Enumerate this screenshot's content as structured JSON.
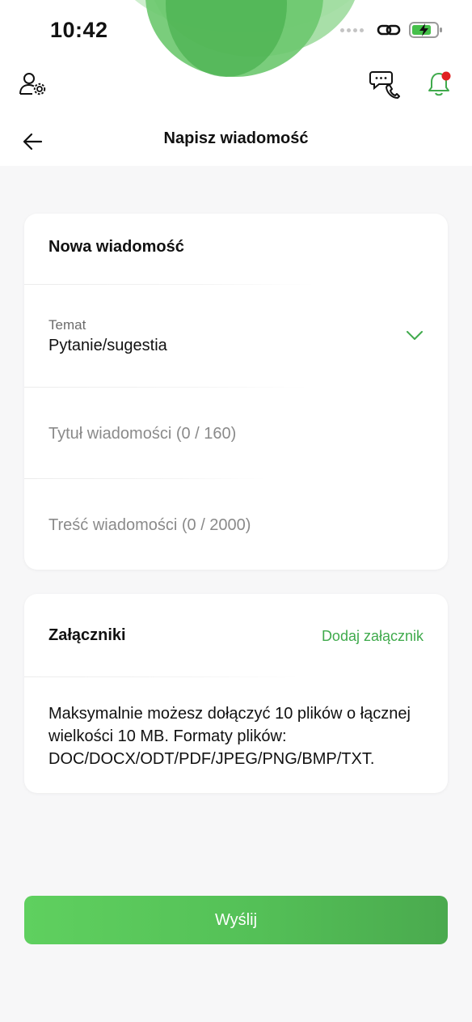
{
  "status_bar": {
    "time": "10:42"
  },
  "header": {
    "title": "Napisz wiadomość"
  },
  "message_card": {
    "title": "Nowa wiadomość",
    "topic_label": "Temat",
    "topic_value": "Pytanie/sugestia",
    "title_placeholder": "Tytuł wiadomości (0 / 160)",
    "body_placeholder": "Treść wiadomości (0 / 2000)"
  },
  "attachments_card": {
    "title": "Załączniki",
    "add_label": "Dodaj załącznik",
    "info": "Maksymalnie możesz dołączyć 10 plików o łącznej wielkości 10 MB. Formaty plików: DOC/DOCX/ODT/PDF/JPEG/PNG/BMP/TXT."
  },
  "send_button": {
    "label": "Wyślij"
  },
  "colors": {
    "accent": "#3faa4c",
    "button_start": "#5fd05f",
    "button_end": "#4aaa4e",
    "notification_dot": "#e02020"
  }
}
